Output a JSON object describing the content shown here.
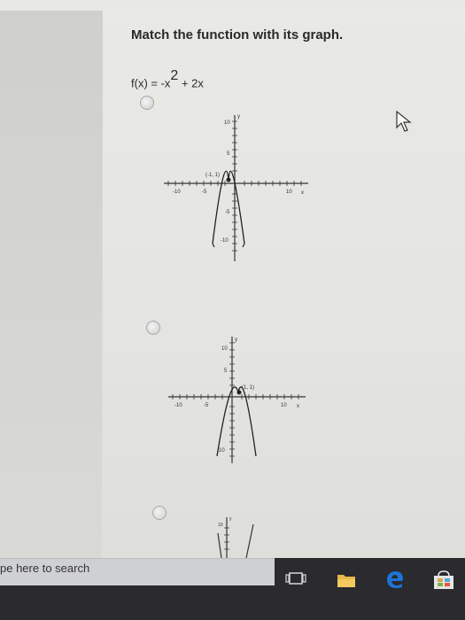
{
  "header": {
    "title": "Match the function with its graph.",
    "function_label": "f(x) = -x² + 2x",
    "function_prefix": "f(x) = -x",
    "function_exponent": "2",
    "function_suffix": " + 2x"
  },
  "options": [
    {
      "graph_labels": {
        "y_axis": "y",
        "x_axis": "x",
        "y_top": "10",
        "y_mid": "5",
        "x_neg": "-10",
        "x_mid_neg": "-5",
        "x_pos": "10",
        "y_neg_mid": "-5",
        "y_neg": "-10",
        "vertex": "(-1, 1)"
      }
    },
    {
      "graph_labels": {
        "y_axis": "y",
        "x_axis": "x",
        "y_top": "10",
        "y_mid": "5",
        "x_neg": "-10",
        "x_mid_neg": "-5",
        "x_pos": "10",
        "y_neg": "-10",
        "vertex": "(1, 1)"
      }
    },
    {
      "graph_labels": {
        "y_axis": "y",
        "y_top": "10"
      }
    }
  ],
  "taskbar": {
    "search_placeholder": "pe here to search"
  },
  "colors": {
    "taskbar": "#2a2a2f",
    "edge_blue": "#1d74d6",
    "store_accent": "#d4a84a"
  }
}
